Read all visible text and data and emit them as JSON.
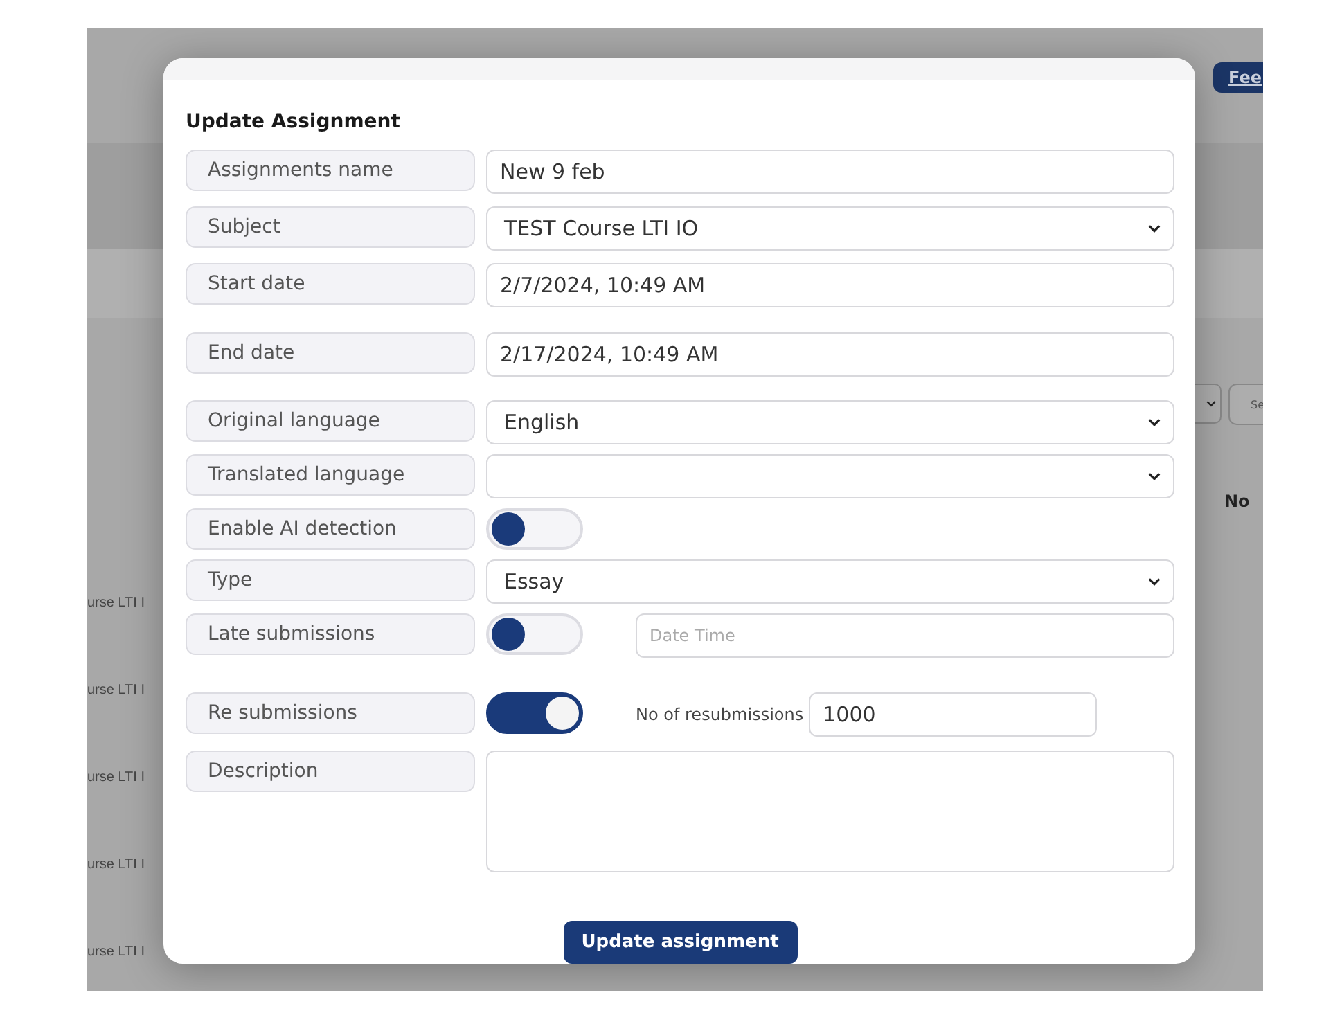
{
  "background": {
    "feedback_button": "Fee",
    "filter_button": "Se",
    "status_text": "No",
    "row_texts": [
      "urse LTI I",
      "urse LTI I",
      "urse LTI I",
      "urse LTI I",
      "urse LTI I"
    ]
  },
  "dialog": {
    "title": "Update Assignment",
    "fields": [
      {
        "kind": "text",
        "label": "Assignments name",
        "value": "New 9 feb"
      },
      {
        "kind": "select",
        "label": "Subject",
        "value": "TEST Course LTI IO"
      },
      {
        "kind": "text",
        "label": "Start date",
        "value": "2/7/2024, 10:49 AM"
      },
      {
        "kind": "text",
        "label": "End date",
        "value": "2/17/2024, 10:49 AM"
      },
      {
        "kind": "select",
        "label": "Original language",
        "value": "English"
      },
      {
        "kind": "select",
        "label": "Translated language"
      },
      {
        "kind": "toggle",
        "label": "Enable AI detection",
        "on": false
      },
      {
        "kind": "select",
        "label": "Type",
        "value": "Essay"
      },
      {
        "kind": "toggle_date",
        "label": "Late submissions",
        "on": false,
        "placeholder": "Date Time"
      },
      {
        "kind": "toggle_count",
        "label": "Re submissions",
        "on": true,
        "count_label": "No of resubmissions",
        "value": "1000"
      },
      {
        "kind": "textarea",
        "label": "Description"
      }
    ],
    "submit": "Update assignment"
  }
}
